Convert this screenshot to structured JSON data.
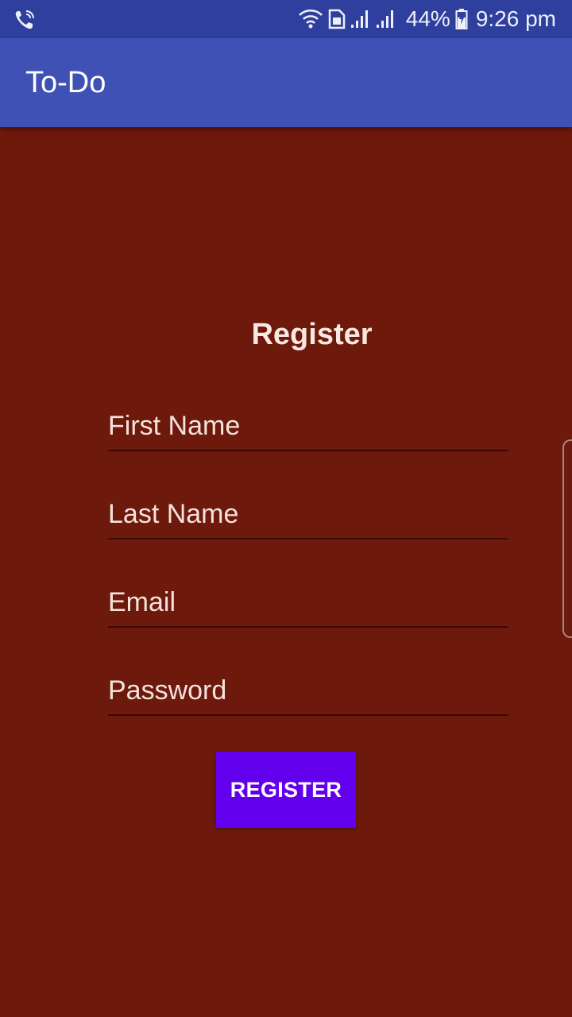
{
  "status_bar": {
    "battery_percent": "44%",
    "time": "9:26 pm",
    "icons": [
      "wifi-calling-icon",
      "wifi-icon",
      "sim-icon",
      "signal-icon",
      "signal-icon",
      "battery-charging-icon"
    ]
  },
  "app_bar": {
    "title": "To-Do"
  },
  "form": {
    "heading": "Register",
    "first_name_placeholder": "First Name",
    "last_name_placeholder": "Last Name",
    "email_placeholder": "Email",
    "password_placeholder": "Password",
    "register_label": "REGISTER"
  },
  "colors": {
    "status_bar": "#2f3f9e",
    "app_bar": "#3f51b5",
    "background": "#6d190b",
    "button": "#6200ee"
  }
}
